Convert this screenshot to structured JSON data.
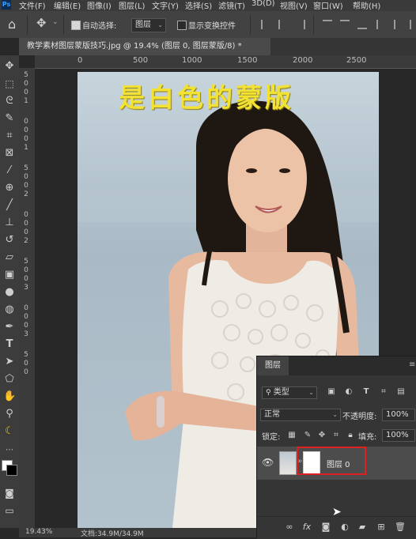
{
  "menu": {
    "logo": "Ps",
    "items": [
      "文件(F)",
      "编辑(E)",
      "图像(I)",
      "图层(L)",
      "文字(Y)",
      "选择(S)",
      "滤镜(T)",
      "3D(D)",
      "视图(V)",
      "窗口(W)",
      "帮助(H)"
    ]
  },
  "options": {
    "auto_select_label": "自动选择:",
    "auto_select_value": "图层",
    "show_transform_label": "显示变换控件"
  },
  "document": {
    "tab_title": "教学素材图层蒙版技巧.jpg @ 19.4% (图层 0, 图层蒙版/8) *",
    "caption": "是白色的蒙版",
    "zoom": "19.43%",
    "doc_info": "文档:34.9M/34.9M"
  },
  "rulers": {
    "h_ticks": [
      "0",
      "500",
      "1000",
      "1500",
      "2000",
      "2500"
    ],
    "v_ticks": [
      "5",
      "0",
      "0",
      "1",
      "0",
      "0",
      "0",
      "1",
      "5",
      "0",
      "0",
      "2",
      "0",
      "0",
      "0",
      "2",
      "5",
      "0",
      "0",
      "3",
      "0",
      "0",
      "0",
      "3",
      "5",
      "0",
      "0"
    ]
  },
  "layers_panel": {
    "tab_label": "图层",
    "filter_label": "类型",
    "blend_mode": "正常",
    "opacity_label": "不透明度:",
    "opacity_value": "100%",
    "lock_label": "锁定:",
    "fill_label": "填充:",
    "fill_value": "100%",
    "layer_name": "图层 0",
    "icons": {
      "eye": "eye-icon",
      "link": "link-icon",
      "fx": "fx",
      "mask": "add-mask-icon"
    }
  },
  "colors": {
    "caption": "#f2e233",
    "highlight_box": "#e02020",
    "panel_bg": "#353535"
  }
}
